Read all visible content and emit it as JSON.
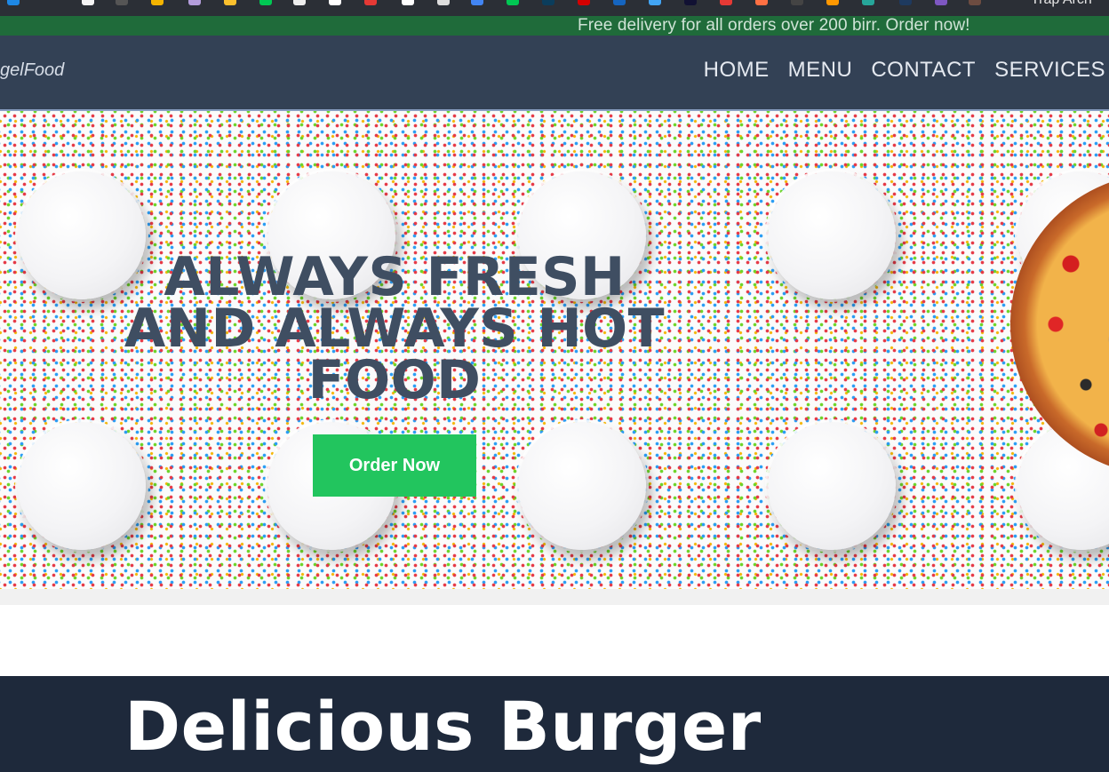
{
  "bookmarks_bar": {
    "icons": [
      {
        "name": "bookmark-icon-1",
        "color": "#1e88e5"
      },
      {
        "name": "bookmark-icon-2",
        "color": "#f5f5f5"
      },
      {
        "name": "bookmark-icon-3",
        "color": "#555555"
      },
      {
        "name": "bookmark-icon-4",
        "color": "#f4b400"
      },
      {
        "name": "bookmark-icon-5",
        "color": "#b39ddb"
      },
      {
        "name": "bookmark-icon-6",
        "color": "#fbc02d"
      },
      {
        "name": "bookmark-icon-7",
        "color": "#00c853"
      },
      {
        "name": "bookmark-icon-8",
        "color": "#eeeeee"
      },
      {
        "name": "bookmark-icon-9",
        "color": "#ffffff"
      },
      {
        "name": "bookmark-icon-10",
        "color": "#e53935"
      },
      {
        "name": "bookmark-icon-11",
        "color": "#ffffff"
      },
      {
        "name": "bookmark-icon-12",
        "color": "#dddddd"
      },
      {
        "name": "bookmark-icon-13",
        "color": "#4285f4"
      },
      {
        "name": "bookmark-icon-14",
        "color": "#00c853"
      },
      {
        "name": "bookmark-icon-15",
        "color": "#0b3d5c"
      },
      {
        "name": "bookmark-icon-16",
        "color": "#d50000"
      },
      {
        "name": "bookmark-icon-17",
        "color": "#1565c0"
      },
      {
        "name": "bookmark-icon-18",
        "color": "#42a5f5"
      },
      {
        "name": "bookmark-icon-19",
        "color": "#111133"
      },
      {
        "name": "bookmark-icon-20",
        "color": "#e53935"
      },
      {
        "name": "bookmark-icon-21",
        "color": "#ff7043"
      },
      {
        "name": "bookmark-icon-22",
        "color": "#444444"
      },
      {
        "name": "bookmark-icon-23",
        "color": "#ff9800"
      },
      {
        "name": "bookmark-icon-24",
        "color": "#26a69a"
      },
      {
        "name": "bookmark-icon-25",
        "color": "#1e3a5f"
      },
      {
        "name": "bookmark-icon-26",
        "color": "#7e57c2"
      },
      {
        "name": "bookmark-icon-27",
        "color": "#6d4c41"
      }
    ],
    "trailing_text": "Trap Arch"
  },
  "promo": {
    "text": "Free delivery for all orders over 200 birr. Order now!"
  },
  "nav": {
    "brand": "gelFood",
    "links": [
      "HOME",
      "MENU",
      "CONTACT",
      "SERVICES"
    ]
  },
  "hero": {
    "headline": "ALWAYS FRESH AND ALWAYS HOT FOOD",
    "cta_label": "Order Now"
  },
  "burger_section": {
    "title": "Delicious Burger"
  },
  "colors": {
    "promo_bg": "#1f6b3a",
    "nav_bg": "#334155",
    "cta_bg": "#22c55e",
    "headline": "#3f4e62",
    "burger_bg": "#1e293b"
  }
}
